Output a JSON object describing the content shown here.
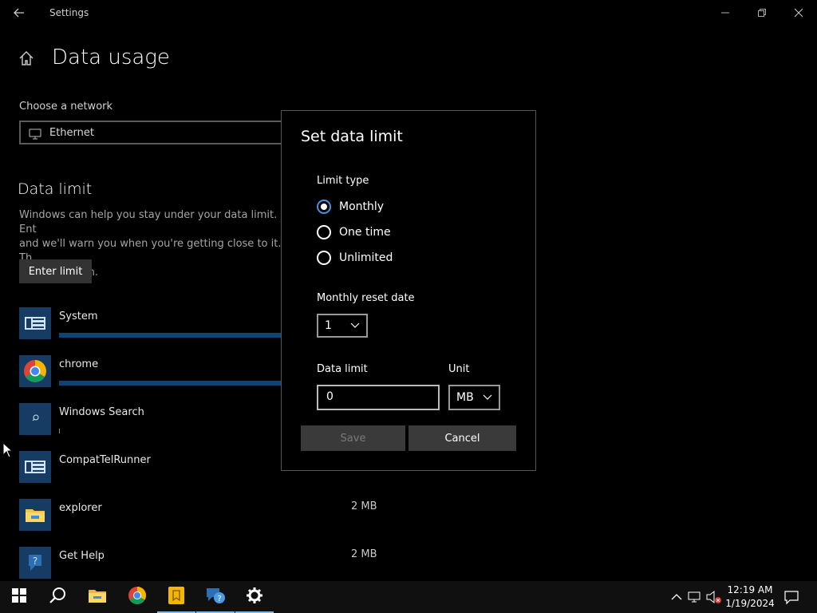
{
  "window": {
    "title": "Settings"
  },
  "page": {
    "title": "Data usage"
  },
  "network": {
    "label": "Choose a network",
    "selected": "Ethernet"
  },
  "data_limit_section": {
    "title": "Data limit",
    "description": "Windows can help you stay under your data limit. Ent\nand we'll warn you when you're getting close to it. Th\nyour data plan.",
    "enter_button": "Enter limit"
  },
  "apps": [
    {
      "name": "System",
      "size": "",
      "usage_fraction": 1.0
    },
    {
      "name": "chrome",
      "size": "",
      "usage_fraction": 1.0
    },
    {
      "name": "Windows Search",
      "size": "",
      "usage_fraction": 0.0
    },
    {
      "name": "CompatTelRunner",
      "size": "",
      "usage_fraction": 0.0
    },
    {
      "name": "explorer",
      "size": "2 MB",
      "usage_fraction": 0.0
    },
    {
      "name": "Get Help",
      "size": "2 MB",
      "usage_fraction": 0.0
    }
  ],
  "dialog": {
    "title": "Set data limit",
    "limit_type_label": "Limit type",
    "limit_types": [
      {
        "label": "Monthly",
        "checked": true
      },
      {
        "label": "One time",
        "checked": false
      },
      {
        "label": "Unlimited",
        "checked": false
      }
    ],
    "reset_date_label": "Monthly reset date",
    "reset_date_value": "1",
    "data_limit_label": "Data limit",
    "data_limit_value": "0",
    "unit_label": "Unit",
    "unit_value": "MB",
    "save_label": "Save",
    "cancel_label": "Cancel"
  },
  "taskbar": {
    "time": "12:19 AM",
    "date": "1/19/2024"
  },
  "colors": {
    "accent": "#4a90e2",
    "usage_bar": "#0e4577",
    "taskbar_active": "#76b9ed"
  }
}
